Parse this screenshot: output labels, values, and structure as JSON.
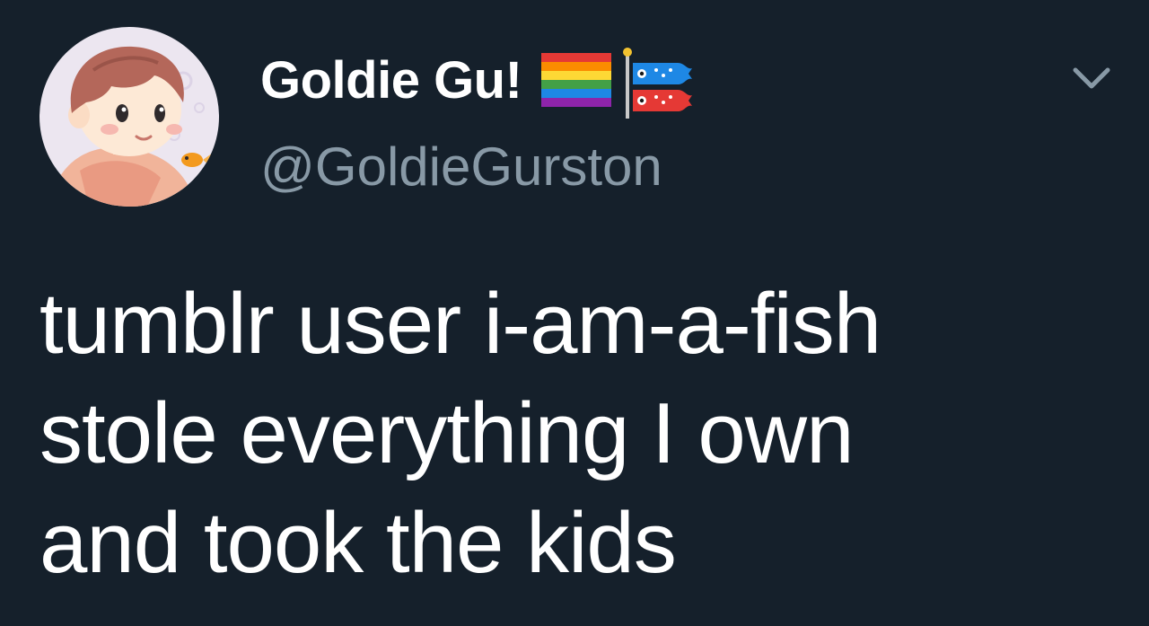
{
  "tweet": {
    "display_name": "Goldie Gu!",
    "handle": "@GoldieGurston",
    "text": "tumblr user i-am-a-fish\nstole everything I own\nand took the kids",
    "name_emoji": [
      "rainbow-flag-icon",
      "carp-streamer-icon"
    ],
    "menu_icon": "chevron-down-icon"
  },
  "colors": {
    "background": "#15202b",
    "primary_text": "#ffffff",
    "secondary_text": "#8899a6"
  }
}
